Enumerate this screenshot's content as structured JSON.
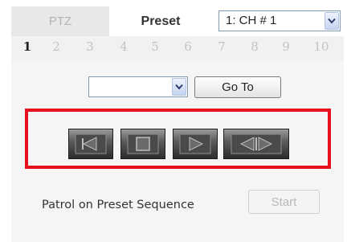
{
  "tabs": {
    "ptz_label": "PTZ",
    "preset_label": "Preset",
    "active": "Preset"
  },
  "channel_select": {
    "value": "1: CH # 1"
  },
  "preset_pages": {
    "numbers": [
      "1",
      "2",
      "3",
      "4",
      "5",
      "6",
      "7",
      "8",
      "9",
      "10"
    ],
    "active": "1"
  },
  "preset_select": {
    "value": ""
  },
  "goto_button": {
    "label": "Go To"
  },
  "controls": [
    {
      "name": "reverse-button",
      "icon": "reverse-icon"
    },
    {
      "name": "stop-button",
      "icon": "stop-icon"
    },
    {
      "name": "play-button",
      "icon": "play-icon"
    },
    {
      "name": "bidirectional-button",
      "icon": "bidirectional-icon"
    }
  ],
  "patrol": {
    "label": "Patrol on Preset Sequence",
    "start_label": "Start",
    "start_enabled": false
  },
  "colors": {
    "highlight": "#e8101c",
    "disabled_text": "#b9b9b9"
  }
}
